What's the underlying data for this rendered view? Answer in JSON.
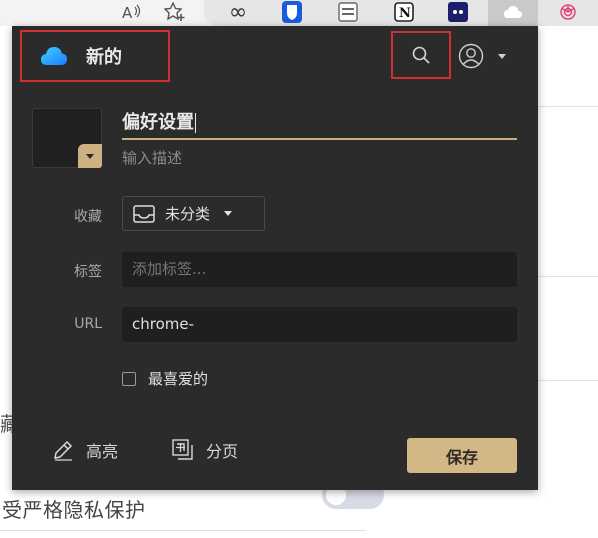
{
  "colors": {
    "popup_bg": "#2b2b2b",
    "accent_gold": "#d3b787",
    "highlight_red": "#d0302f",
    "input_bg": "#1f1f1f"
  },
  "browser_toolbar": {
    "icons": [
      "read-aloud-icon",
      "add-favorite-icon",
      "infinity-extension-icon",
      "bitwarden-icon",
      "reader-extension-icon",
      "notion-icon",
      "ghost-extension-icon",
      "cloud-extension-icon",
      "openai-icon"
    ]
  },
  "background_page": {
    "left_fragment": "藏",
    "bottom_text": "受严格隐私保护"
  },
  "popup": {
    "brand": {
      "name": "新的",
      "logo_icon": "cloud-logo-icon"
    },
    "cover": {
      "icon": "dropdown-caret-icon"
    },
    "title_value": "偏好设置",
    "description_placeholder": "输入描述",
    "collection": {
      "label": "收藏",
      "value": "未分类",
      "icon": "inbox-icon"
    },
    "tags": {
      "label": "标签",
      "placeholder": "添加标签..."
    },
    "url": {
      "label": "URL",
      "value": "chrome-"
    },
    "favorite": {
      "label": "最喜爱的",
      "checked": false
    },
    "footer": {
      "highlight_label": "高亮",
      "split_label": "分页",
      "save_label": "保存"
    }
  }
}
